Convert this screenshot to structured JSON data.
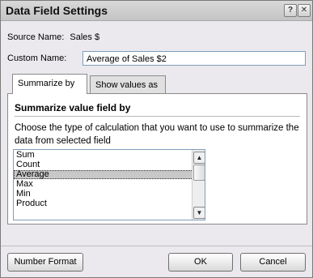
{
  "dialog": {
    "title": "Data Field Settings",
    "help_glyph": "?",
    "close_glyph": "✕"
  },
  "source": {
    "label": "Source Name:",
    "value": "Sales $"
  },
  "custom": {
    "label": "Custom Name:",
    "value": "Average of Sales $2"
  },
  "tabs": [
    {
      "label": "Summarize by"
    },
    {
      "label": "Show values as"
    }
  ],
  "panel": {
    "heading": "Summarize value field by",
    "description": "Choose the type of calculation that you want to use to summarize the data from selected field"
  },
  "list": {
    "items": [
      "Sum",
      "Count",
      "Average",
      "Max",
      "Min",
      "Product"
    ],
    "selected": "Average"
  },
  "buttons": {
    "number_format": "Number Format",
    "ok": "OK",
    "cancel": "Cancel"
  },
  "icons": {
    "scroll_up": "▲",
    "scroll_down": "▼"
  }
}
